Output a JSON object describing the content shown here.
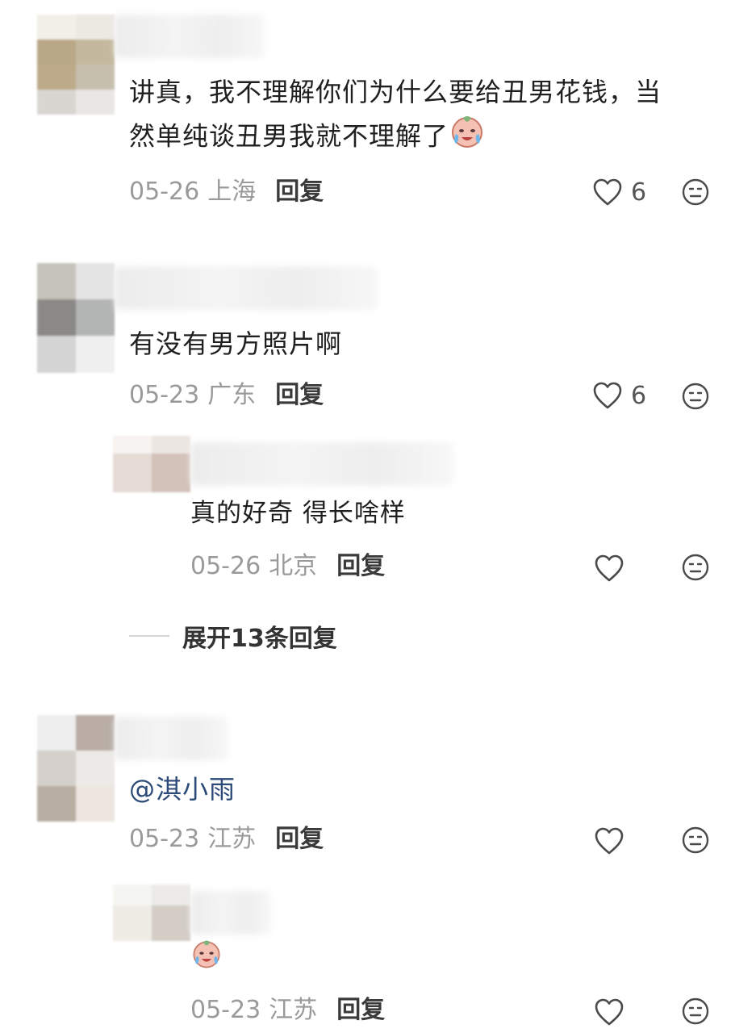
{
  "comments": [
    {
      "text": "讲真，我不理解你们为什么要给丑男花钱，当",
      "text2": "然单纯谈丑男我就不理解了",
      "emoji": "crying-face-emoji",
      "date": "05-26",
      "location": "上海",
      "reply_label": "回复",
      "likes": "6"
    },
    {
      "text": "有没有男方照片啊",
      "date": "05-23",
      "location": "广东",
      "reply_label": "回复",
      "likes": "6",
      "replies": [
        {
          "text": "真的好奇  得长啥样",
          "date": "05-26",
          "location": "北京",
          "reply_label": "回复"
        }
      ],
      "expand_label": "展开13条回复"
    },
    {
      "text": "@淇小雨",
      "date": "05-23",
      "location": "江苏",
      "reply_label": "回复",
      "replies": [
        {
          "emoji": "crying-face-emoji",
          "date": "05-23",
          "location": "江苏",
          "reply_label": "回复"
        }
      ]
    }
  ],
  "colors": {
    "text": "#1f1f1f",
    "meta": "#9a9a9a",
    "mention": "#2b4a78",
    "icon": "#4a4a4a"
  }
}
